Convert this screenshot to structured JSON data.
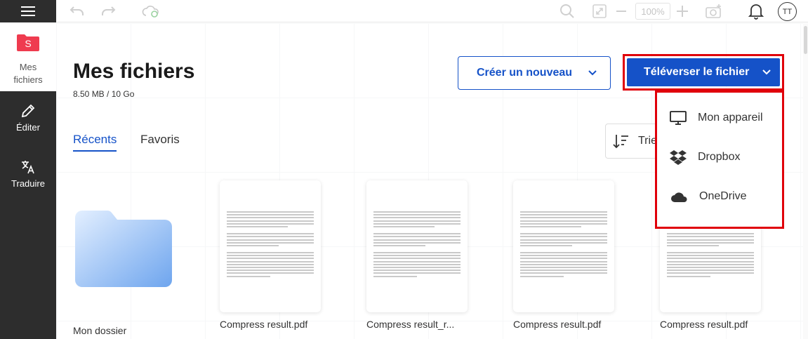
{
  "sidebar": {
    "menu_icon": "hamburger-icon",
    "logo_letter": "S",
    "logo_label_line1": "Mes",
    "logo_label_line2": "fichiers",
    "items": [
      {
        "label": "Éditer",
        "icon": "pencil-icon"
      },
      {
        "label": "Traduire",
        "icon": "translate-icon"
      }
    ]
  },
  "topbar": {
    "zoom": "100%",
    "avatar_initials": "TT"
  },
  "main": {
    "title": "Mes fichiers",
    "storage": "8.50 MB / 10 Go",
    "tabs": [
      {
        "label": "Récents",
        "active": true
      },
      {
        "label": "Favoris",
        "active": false
      }
    ],
    "create_button": "Créer un nouveau",
    "upload_button": "Téléverser le fichier",
    "sort_label": "Trie",
    "upload_menu": [
      {
        "label": "Mon appareil",
        "icon": "monitor-icon"
      },
      {
        "label": "Dropbox",
        "icon": "dropbox-icon"
      },
      {
        "label": "OneDrive",
        "icon": "onedrive-icon"
      }
    ],
    "folder": {
      "name": "Mon dossier"
    },
    "files": [
      {
        "name": "Compress result.pdf"
      },
      {
        "name": "Compress result_r..."
      },
      {
        "name": "Compress result.pdf"
      },
      {
        "name": "Compress result.pdf"
      }
    ]
  },
  "colors": {
    "accent": "#1552c8",
    "highlight": "#e0000a",
    "logo": "#ef3b4f",
    "sidebar": "#2d2d2d"
  }
}
